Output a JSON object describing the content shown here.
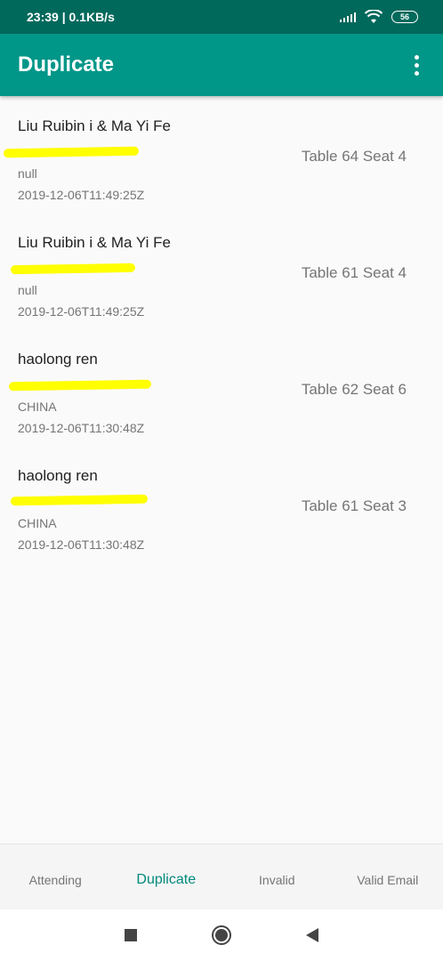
{
  "status": {
    "time_speed": "23:39 | 0.1KB/s",
    "battery": "56"
  },
  "appbar": {
    "title": "Duplicate"
  },
  "items": [
    {
      "name": "Liu Ruibin i & Ma Yi Fe",
      "seat": "Table 64 Seat 4",
      "country": "null",
      "time": "2019-12-06T11:49:25Z"
    },
    {
      "name": "Liu Ruibin i & Ma Yi Fe",
      "seat": "Table 61 Seat 4",
      "country": "null",
      "time": "2019-12-06T11:49:25Z"
    },
    {
      "name": "haolong ren",
      "seat": "Table 62 Seat 6",
      "country": "CHINA",
      "time": "2019-12-06T11:30:48Z"
    },
    {
      "name": "haolong ren",
      "seat": "Table 61 Seat 3",
      "country": "CHINA",
      "time": "2019-12-06T11:30:48Z"
    }
  ],
  "tabs": [
    {
      "label": "Attending"
    },
    {
      "label": "Duplicate"
    },
    {
      "label": "Invalid"
    },
    {
      "label": "Valid Email"
    }
  ],
  "colors": {
    "primary": "#009688",
    "primary_dark": "#00695c",
    "accent": "#00897b",
    "redaction": "#ffff00"
  },
  "icons": [
    "wifi-icon",
    "signal-icon",
    "battery-icon",
    "more-vert-icon",
    "recents-icon",
    "home-icon",
    "back-icon"
  ]
}
